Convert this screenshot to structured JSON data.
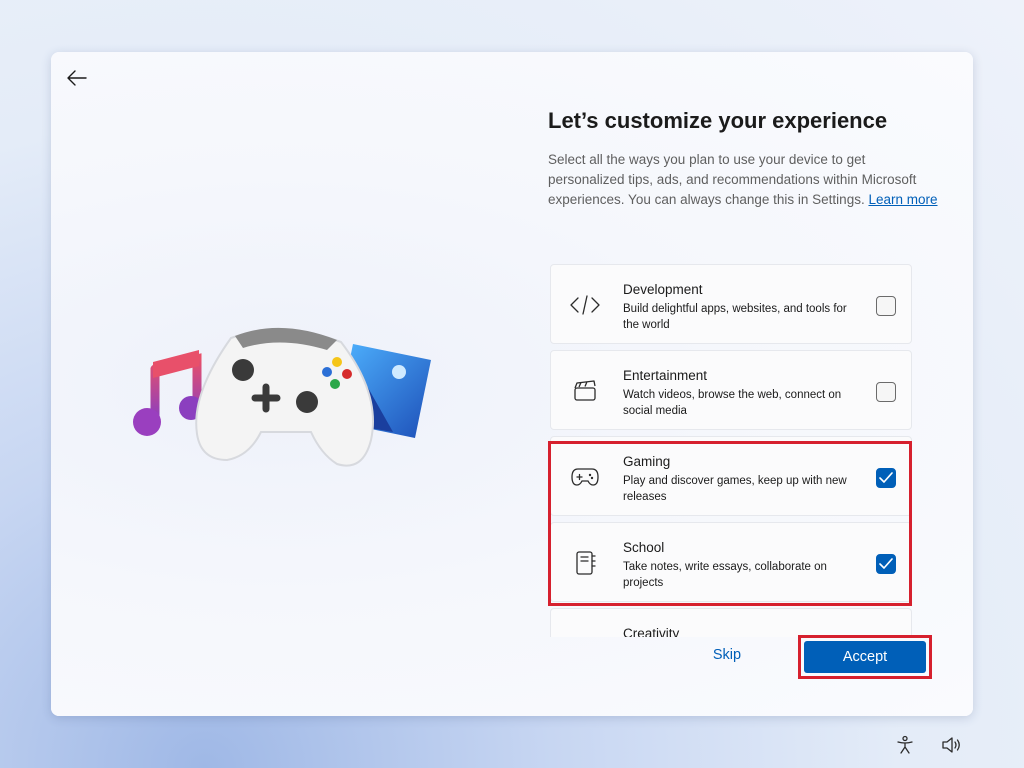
{
  "header": {
    "title": "Let’s customize your experience",
    "description": "Select all the ways you plan to use your device to get personalized tips, ads, and recommendations within Microsoft experiences. You can always change this in Settings.",
    "learn_more": "Learn more"
  },
  "options": [
    {
      "name": "Development",
      "description": "Build delightful apps, websites, and tools for the world",
      "icon": "code-icon",
      "checked": false
    },
    {
      "name": "Entertainment",
      "description": "Watch videos, browse the web, connect on social media",
      "icon": "clapperboard-icon",
      "checked": false
    },
    {
      "name": "Gaming",
      "description": "Play and discover games, keep up with new releases",
      "icon": "gamepad-icon",
      "checked": true
    },
    {
      "name": "School",
      "description": "Take notes, write essays, collaborate on projects",
      "icon": "notebook-icon",
      "checked": true
    },
    {
      "name": "Creativity",
      "description": "",
      "icon": "",
      "checked": false
    }
  ],
  "footer": {
    "skip_label": "Skip",
    "accept_label": "Accept"
  },
  "colors": {
    "accent": "#005fb8",
    "highlight": "#d6202e"
  },
  "tray_icons": [
    "accessibility-icon",
    "volume-icon"
  ]
}
